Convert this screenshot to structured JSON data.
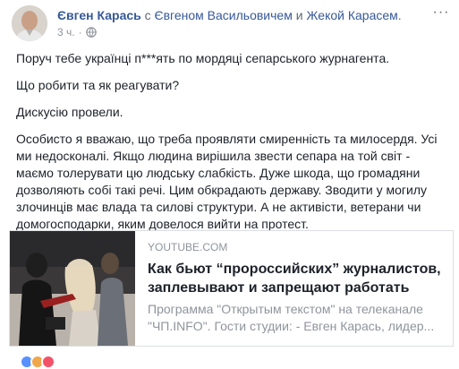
{
  "post": {
    "author": "Євген Карась",
    "with_prefix": "с",
    "tagged_1": "Євгеном Васильовичем",
    "and_word": "и",
    "tagged_2": "Жекой Карасем",
    "period": ".",
    "time": "3 ч.",
    "more_label": "···",
    "paragraphs": [
      "Поруч тебе українці п***ять по мордяці сепарського журнагента.",
      "Що робити та як реагувати?",
      "Дискусію провели.",
      "Особисто я вважаю, що треба проявляти смиренність та милосердя. Усі ми недосконалі. Якщо людина вирішила звести сепара на той світ - маємо толерувати цю людську слабкість. Дуже шкода, що громадяни дозволяють собі такі речі. Цим обкрадають державу. Зводити у могилу злочинців має влада та силові структури. А не активісти, ветерани чи домогосподарки, яким довелося вийти на протест."
    ]
  },
  "link_card": {
    "source": "YOUTUBE.COM",
    "title": "Как бьют “пророссийских” журналистов, заплевывают и запрещают работать",
    "description": "Программа \"Открытым текстом\" на телеканале \"ЧП.INFO\". Гости студии: - Евген Карась, лидер...",
    "thumbnail_icon": "news-video-thumbnail"
  },
  "colors": {
    "link": "#365899",
    "muted": "#90949c",
    "text": "#1d2129",
    "border": "#dddfe2"
  }
}
